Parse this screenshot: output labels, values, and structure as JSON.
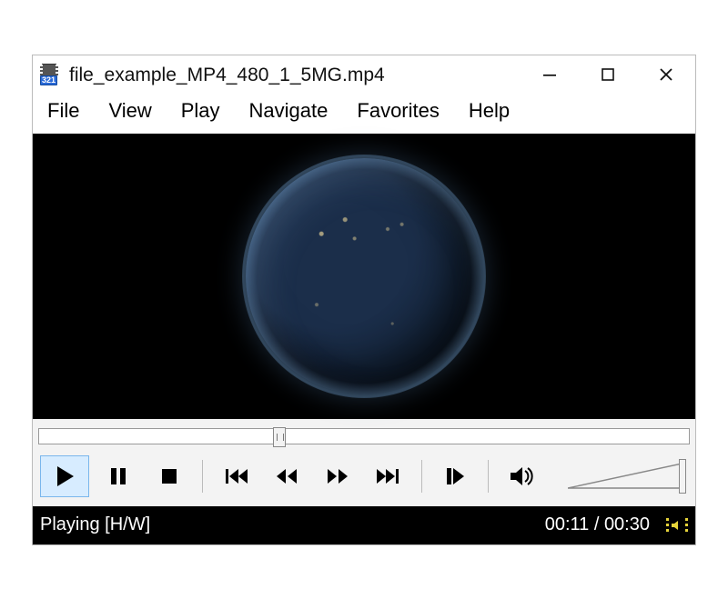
{
  "titlebar": {
    "app_badge": "321",
    "title": "file_example_MP4_480_1_5MG.mp4"
  },
  "menu": {
    "items": [
      "File",
      "View",
      "Play",
      "Navigate",
      "Favorites",
      "Help"
    ]
  },
  "seek": {
    "position_pct": 37
  },
  "controls": {
    "play": "Play",
    "pause": "Pause",
    "stop": "Stop",
    "prev": "Previous",
    "rewind": "Rewind",
    "forward": "Forward",
    "next": "Next",
    "step": "Step",
    "mute": "Mute"
  },
  "volume": {
    "level_pct": 100
  },
  "status": {
    "state": "Playing [H/W]",
    "time": "00:11 / 00:30"
  }
}
